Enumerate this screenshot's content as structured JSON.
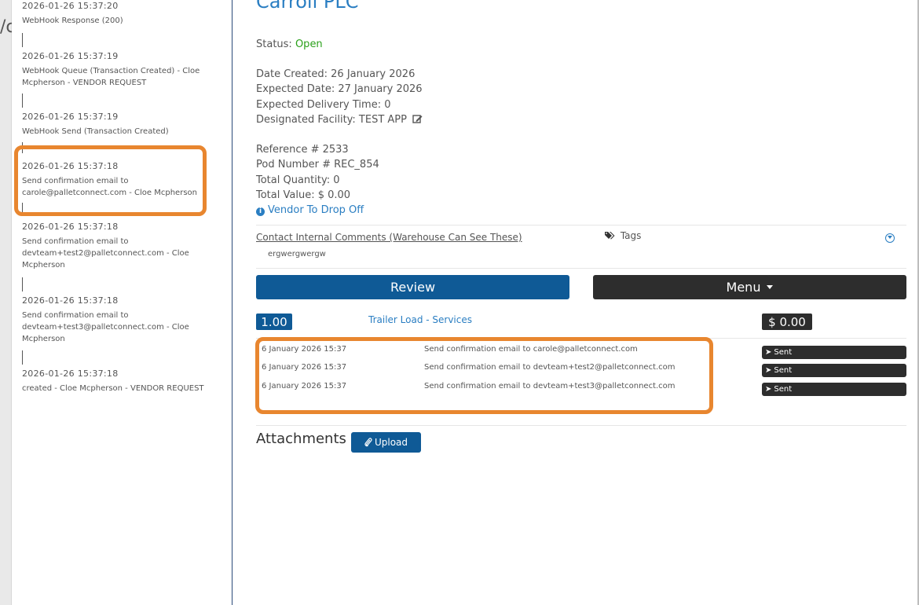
{
  "gutter": {
    "text": "/c"
  },
  "history": {
    "entries": [
      {
        "time": "2026-01-26 15:37:20",
        "desc": "WebHook Response (200)"
      },
      {
        "time": "2026-01-26 15:37:19",
        "desc": "WebHook Queue (Transaction Created) - Cloe Mcpherson - VENDOR REQUEST"
      },
      {
        "time": "2026-01-26 15:37:19",
        "desc": "WebHook Send (Transaction Created)"
      },
      {
        "time": "2026-01-26 15:37:18",
        "desc": "Send confirmation email to carole@palletconnect.com - Cloe Mcpherson"
      },
      {
        "time": "2026-01-26 15:37:18",
        "desc": "Send confirmation email to devteam+test2@palletconnect.com - Cloe Mcpherson"
      },
      {
        "time": "2026-01-26 15:37:18",
        "desc": "Send confirmation email to devteam+test3@palletconnect.com - Cloe Mcpherson"
      },
      {
        "time": "2026-01-26 15:37:18",
        "desc": "created - Cloe Mcpherson - VENDOR REQUEST"
      }
    ]
  },
  "main": {
    "company": "Carroll PLC",
    "status_label": "Status:",
    "status_value": "Open",
    "date_created": "Date Created: 26 January 2026",
    "expected_date": "Expected Date: 27 January 2026",
    "expected_delivery": "Expected Delivery Time: 0",
    "facility": "Designated Facility: TEST APP",
    "reference": "Reference # 2533",
    "pod_number": "Pod Number # REC_854",
    "total_quantity": "Total Quantity: 0",
    "total_value": "Total Value: $ 0.00",
    "vendor_link": "Vendor To Drop Off",
    "comments_link": "Contact Internal Comments (Warehouse Can See These)",
    "comment_text": "ergwergwergw",
    "tags_label": "Tags",
    "review_label": "Review",
    "menu_label": "Menu",
    "line_qty": "1.00",
    "line_service": "Trailer Load - Services",
    "line_value": "$ 0.00",
    "emails": [
      {
        "date": "6 January 2026 15:37",
        "desc": "Send confirmation email to carole@palletconnect.com",
        "status": "Sent"
      },
      {
        "date": "6 January 2026 15:37",
        "desc": "Send confirmation email to devteam+test2@palletconnect.com",
        "status": "Sent"
      },
      {
        "date": "6 January 2026 15:37",
        "desc": "Send confirmation email to devteam+test3@palletconnect.com",
        "status": "Sent"
      }
    ],
    "attachments_label": "Attachments",
    "upload_label": "Upload"
  },
  "colors": {
    "accent": "#2a7ec2",
    "primary_button": "#0f5a96",
    "dark_button": "#2d2d2d",
    "highlight": "#e8862f",
    "status_open": "#2aa01a"
  }
}
